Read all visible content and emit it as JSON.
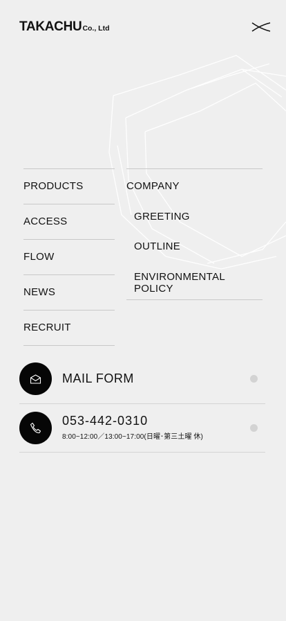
{
  "header": {
    "logo_main": "TAKACHU",
    "logo_sub": "Co., Ltd",
    "close_label": "close menu"
  },
  "nav_left": [
    {
      "label": "PRODUCTS"
    },
    {
      "label": "ACCESS"
    },
    {
      "label": "FLOW"
    },
    {
      "label": "NEWS"
    },
    {
      "label": "RECRUIT"
    }
  ],
  "nav_right": {
    "company": "COMPANY",
    "sub_items": [
      {
        "label": "GREETING"
      },
      {
        "label": "OUTLINE"
      },
      {
        "label": "ENVIRONMENTAL POLICY"
      }
    ]
  },
  "contact": {
    "mail_label": "MAIL FORM",
    "tel_number": "053-442-0310",
    "tel_hours": "8:00~12:00／13:00~17:00(日曜･第三土曜 休)"
  },
  "icons": {
    "mail": "envelope-icon",
    "tel": "phone-icon",
    "close": "close-icon"
  },
  "colors": {
    "background": "#efefef",
    "text": "#111111",
    "circle": "#060606",
    "divider": "#c8c8c8",
    "dot": "#d3d3d3"
  }
}
